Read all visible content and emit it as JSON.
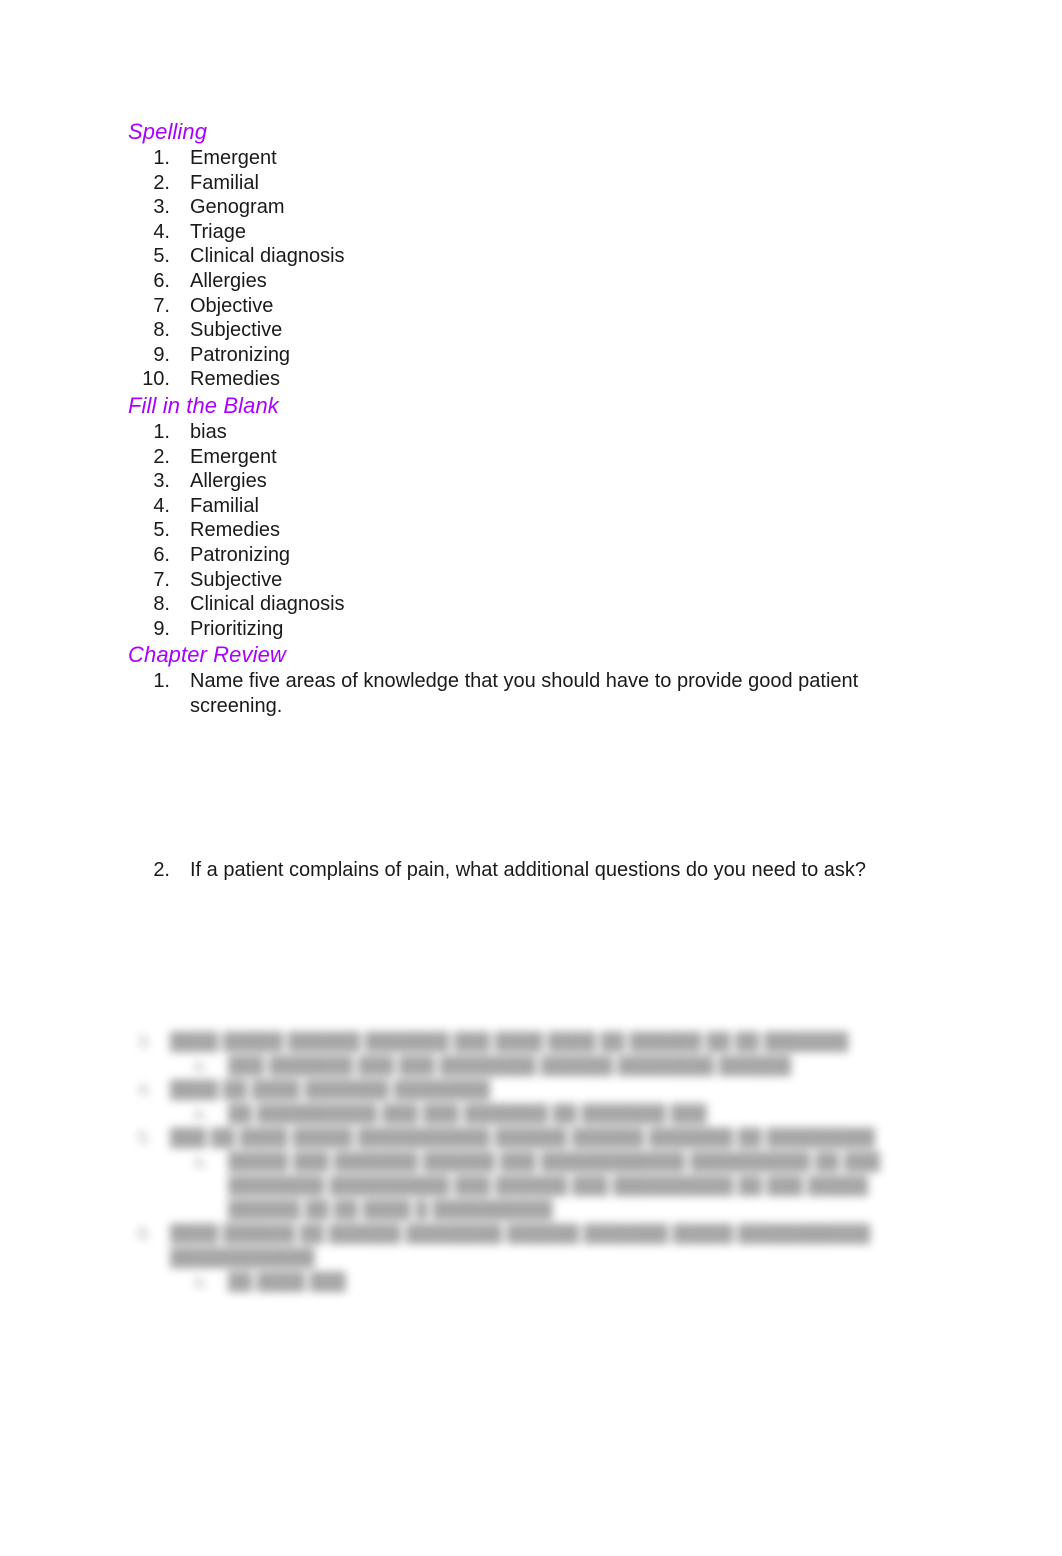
{
  "document": {
    "page_background": "#ffffff",
    "heading_color": "#aa00ff",
    "body_color": "#1a1a1a"
  },
  "sections": {
    "spelling": {
      "heading": "Spelling",
      "items": [
        {
          "marker": "1.",
          "text": "Emergent"
        },
        {
          "marker": "2.",
          "text": "Familial"
        },
        {
          "marker": "3.",
          "text": "Genogram"
        },
        {
          "marker": "4.",
          "text": "Triage"
        },
        {
          "marker": "5.",
          "text": "Clinical diagnosis"
        },
        {
          "marker": "6.",
          "text": "Allergies"
        },
        {
          "marker": "7.",
          "text": "Objective"
        },
        {
          "marker": "8.",
          "text": "Subjective"
        },
        {
          "marker": "9.",
          "text": "Patronizing"
        },
        {
          "marker": "10.",
          "text": "Remedies"
        }
      ]
    },
    "fill_in_the_blank": {
      "heading": "Fill in the Blank",
      "items": [
        {
          "marker": "1.",
          "text": "bias"
        },
        {
          "marker": "2.",
          "text": "Emergent"
        },
        {
          "marker": "3.",
          "text": "Allergies"
        },
        {
          "marker": "4.",
          "text": "Familial"
        },
        {
          "marker": "5.",
          "text": "Remedies"
        },
        {
          "marker": "6.",
          "text": "Patronizing"
        },
        {
          "marker": "7.",
          "text": "Subjective"
        },
        {
          "marker": "8.",
          "text": "Clinical diagnosis"
        },
        {
          "marker": "9.",
          "text": "Prioritizing"
        }
      ]
    },
    "chapter_review": {
      "heading": "Chapter Review",
      "items": [
        {
          "marker": "1.",
          "text": "Name five areas of knowledge that you should have to provide good patient screening."
        },
        {
          "marker": "2.",
          "text": "If a patient complains of pain, what additional questions do you need to ask?"
        }
      ]
    },
    "obscured": {
      "note": "blurred illegible text",
      "items": [
        {
          "marker": "3.",
          "text": "████ █████ ██████ ███████ ███ ████ ████ ██ ██████ ██ ██ ███████",
          "subitems": [
            {
              "marker": "a.",
              "text": "███ ███████ ███ ███ ████████ ██████ ████████ ██████"
            }
          ]
        },
        {
          "marker": "4.",
          "text": "████ ██ ████ ███████ ████████",
          "subitems": [
            {
              "marker": "a.",
              "text": "██ ██████████ ███ ███ ███████ ██ ███████ ███"
            }
          ]
        },
        {
          "marker": "5.",
          "text": "███ ██ ████ █████ ███████████ ██████ ██████ ███████ ██ █████████",
          "subitems": [
            {
              "marker": "a.",
              "text": "█████ ███ ███████ ██████ ███ ████████████ ██████████ ██ ███ ████████ ██████████ ███ ██████ ███ ██████████ ██ ███ █████ ██████ ██ ██ ████ █ ██████████"
            }
          ]
        },
        {
          "marker": "6.",
          "text": "████ ██████ ██ ██████ ████████ ██████ ███████ █████ ███████████ ████████████",
          "subitems": [
            {
              "marker": "a.",
              "text": "██ ████ ███"
            }
          ]
        }
      ]
    }
  }
}
